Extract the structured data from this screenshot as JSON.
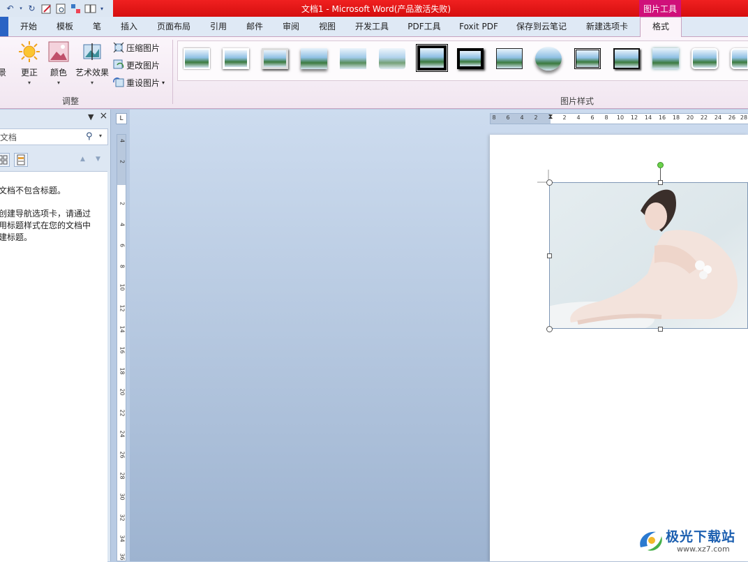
{
  "window": {
    "title": "文档1 - Microsoft Word(产品激活失败)",
    "contextual_tab_group": "图片工具"
  },
  "tabs": [
    {
      "label": "开始"
    },
    {
      "label": "模板"
    },
    {
      "label": "笔"
    },
    {
      "label": "插入"
    },
    {
      "label": "页面布局"
    },
    {
      "label": "引用"
    },
    {
      "label": "邮件"
    },
    {
      "label": "审阅"
    },
    {
      "label": "视图"
    },
    {
      "label": "开发工具"
    },
    {
      "label": "PDF工具"
    },
    {
      "label": "Foxit PDF"
    },
    {
      "label": "保存到云笔记"
    },
    {
      "label": "新建选项卡"
    },
    {
      "label": "格式",
      "active": true
    }
  ],
  "ribbon": {
    "adjust": {
      "partial_label": "景",
      "corrections": "更正",
      "color": "颜色",
      "artistic_effects": "艺术效果",
      "compress": "压缩图片",
      "change": "更改图片",
      "reset": "重设图片",
      "group_label": "调整"
    },
    "picture_styles": {
      "group_label": "图片样式",
      "count": 14
    }
  },
  "nav_pane": {
    "search_text": "文档",
    "message1": "文档不包含标题。",
    "message2": "创建导航选项卡，请通过\n用标题样式在您的文档中\n建标题。"
  },
  "rulers": {
    "horizontal": [
      "8",
      "6",
      "4",
      "2",
      "",
      "2",
      "4",
      "6",
      "8",
      "10",
      "12",
      "14",
      "16",
      "18",
      "20",
      "22",
      "24",
      "26",
      "28"
    ],
    "vertical": [
      "4",
      "2",
      "",
      "2",
      "4",
      "6",
      "8",
      "10",
      "12",
      "14",
      "16",
      "18",
      "20",
      "22",
      "24",
      "26",
      "28",
      "30",
      "32",
      "34",
      "36"
    ]
  },
  "watermark": {
    "text": "极光下载站",
    "url": "www.xz7.com"
  },
  "colors": {
    "title_red": "#e31414",
    "contextual_pink": "#d0107a",
    "doc_background": "#b9cbe3"
  }
}
